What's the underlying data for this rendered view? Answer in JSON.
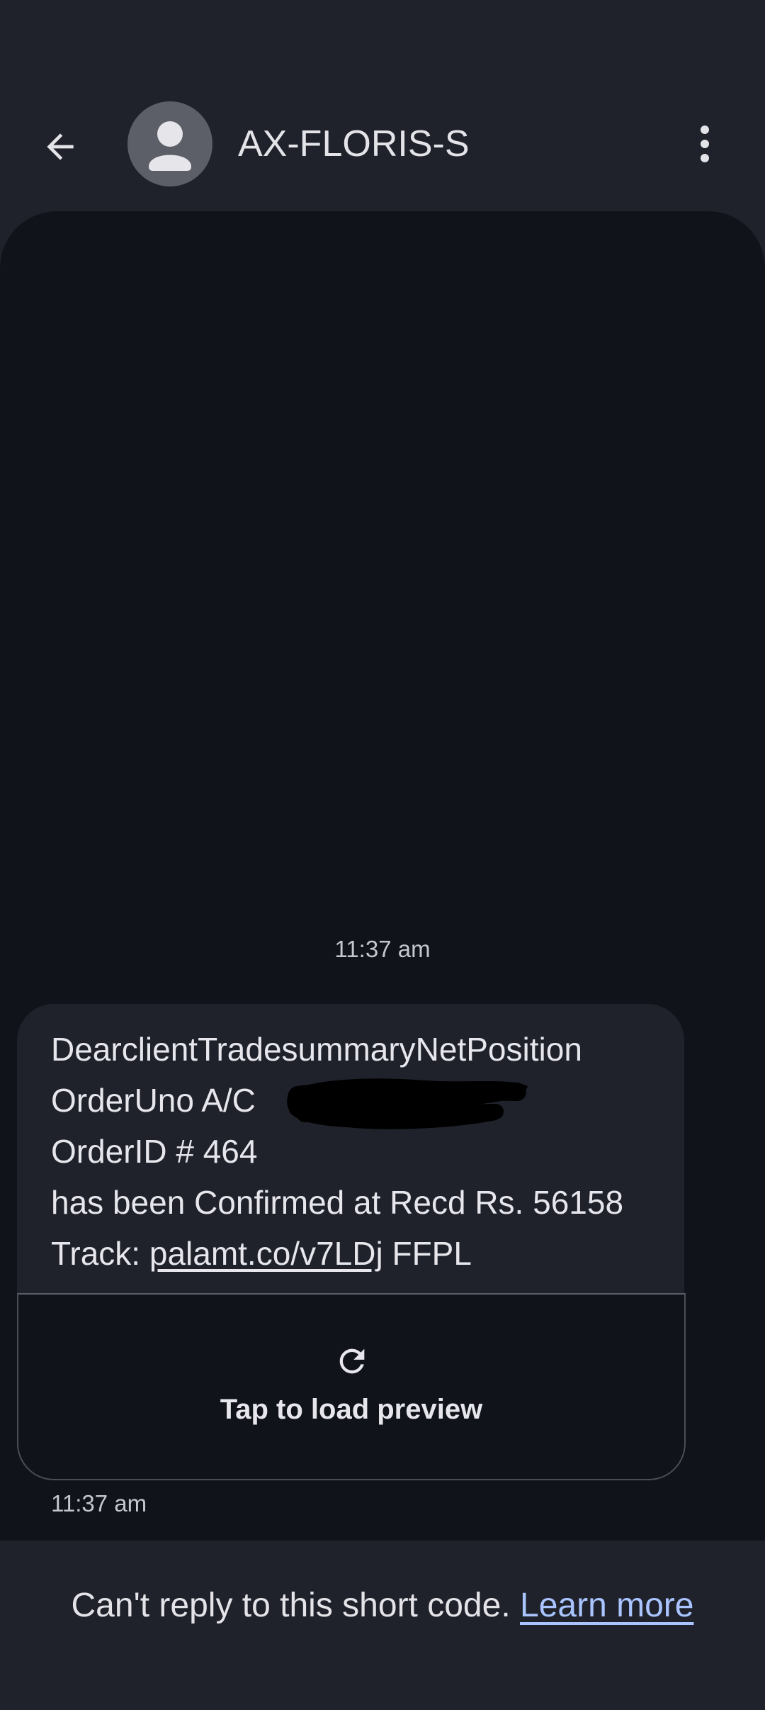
{
  "header": {
    "contact_name": "AX-FLORIS-S",
    "icons": {
      "back": "arrow-back-icon",
      "avatar": "person-icon",
      "more": "more-vert-icon"
    }
  },
  "conversation": {
    "top_timestamp": "11:37 am",
    "message": {
      "line1": "DearclientTradesummaryNetPosition",
      "line2": "OrderUno A/C",
      "line3": "OrderID # 464",
      "line4": "has been Confirmed at Recd Rs. 56158",
      "line5_prefix": "Track: ",
      "link_text": "palamt.co/v7LDj",
      "line5_suffix": " FFPL",
      "redacted": true
    },
    "preview": {
      "label": "Tap to load preview",
      "icon": "refresh-icon"
    },
    "message_timestamp": "11:37 am"
  },
  "footer": {
    "text": "Can't reply to this short code.",
    "link": "Learn more"
  },
  "colors": {
    "background": "#1f222b",
    "conversation_bg": "#11131a",
    "bubble_bg": "#1f222b",
    "link": "#a9c4ff"
  }
}
